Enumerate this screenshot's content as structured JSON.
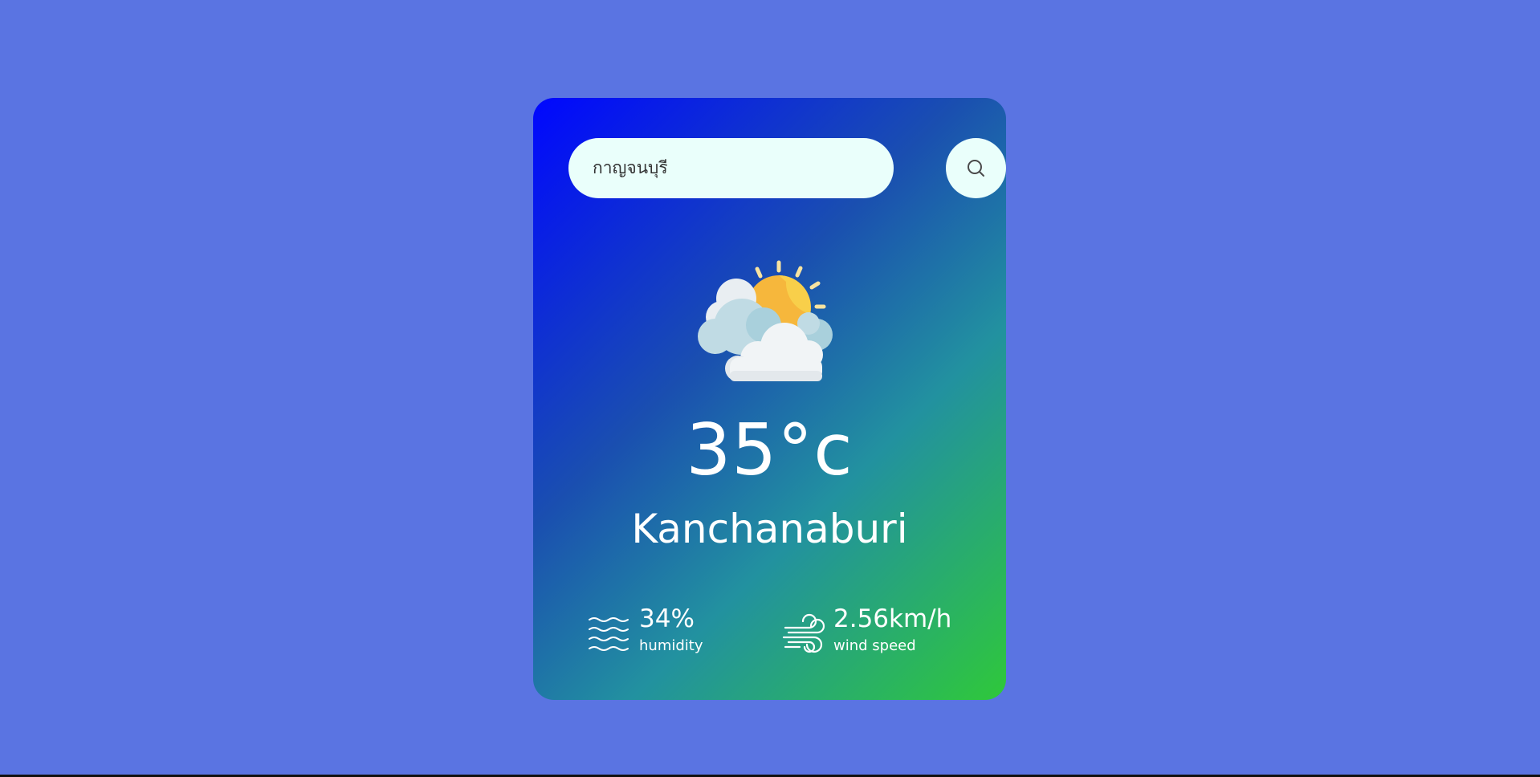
{
  "search": {
    "value": "กาญจนบุรี",
    "icon": "search-icon"
  },
  "weather": {
    "icon": "partly-cloudy-icon",
    "temperature": "35°c",
    "city": "Kanchanaburi"
  },
  "details": {
    "humidity": {
      "icon": "humidity-waves-icon",
      "value": "34%",
      "label": "humidity"
    },
    "wind": {
      "icon": "wind-icon",
      "value": "2.56km/h",
      "label": "wind speed"
    }
  },
  "colors": {
    "page_background": "#5a74e2",
    "card_gradient_start": "#0007ff",
    "card_gradient_end": "#2fc83a",
    "input_background": "#eafffb",
    "text": "#ffffff"
  }
}
